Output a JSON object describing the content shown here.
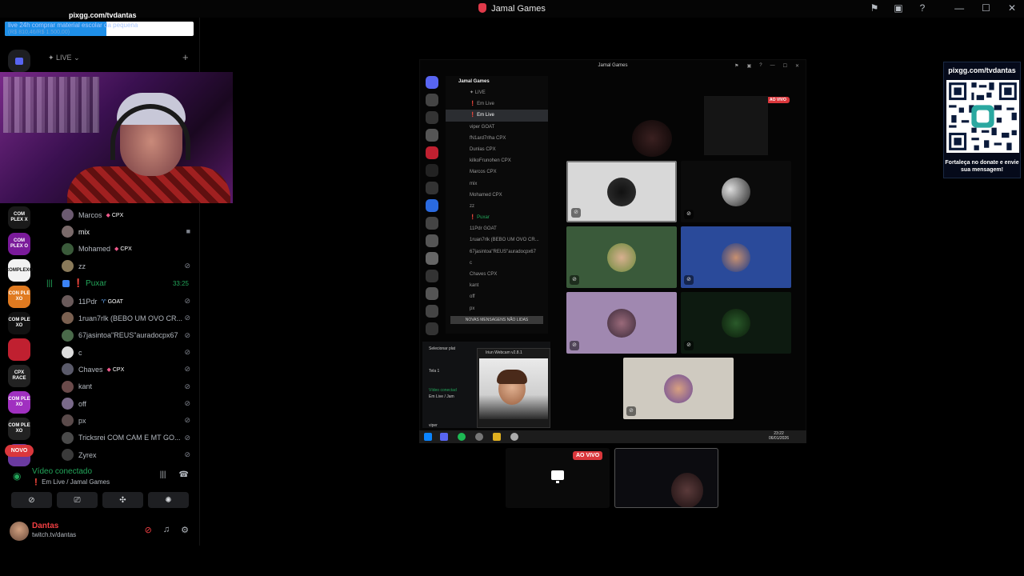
{
  "window": {
    "title": "Jamal Games"
  },
  "stream_overlay": {
    "url": "pixgg.com/tvdantas",
    "goal_text": "live 24h comprar material escolar da pequena",
    "goal_amount": "(R$ 810,46/R$ 1.500,00)",
    "goal_progress": 0.54
  },
  "sidebar": {
    "live_category": "✦ LIVE",
    "novo_badge": "NOVO",
    "members_top": [
      {
        "name": "Marcos",
        "badge": "CPX",
        "badge_type": "gem",
        "muted": false,
        "avatar_color": "#6b5a70"
      },
      {
        "name": "mix",
        "badge": "",
        "badge_type": "",
        "muted": false,
        "camera": true,
        "avatar_color": "#7a6a6a"
      },
      {
        "name": "Mohamed",
        "badge": "CPX",
        "badge_type": "gem",
        "muted": false,
        "avatar_color": "#3a5a3a"
      },
      {
        "name": "zz",
        "badge": "",
        "badge_type": "",
        "muted": true,
        "avatar_color": "#8a7a5a"
      }
    ],
    "voice_channel": {
      "name": "❗ Puxar",
      "time": "33:25"
    },
    "members_bottom": [
      {
        "name": "11Pdr",
        "badge": "GOAT",
        "badge_type": "goat",
        "avatar_color": "#6a5a5a"
      },
      {
        "name": "1ruan7rlk (BEBO UM OVO CR...",
        "badge": "",
        "badge_type": "",
        "avatar_color": "#7a6050"
      },
      {
        "name": "67jasintoa\"REUS\"auradocpx67",
        "badge": "",
        "badge_type": "",
        "avatar_color": "#4a6a4a"
      },
      {
        "name": "c",
        "badge": "",
        "badge_type": "",
        "avatar_color": "#ddd"
      },
      {
        "name": "Chaves",
        "badge": "CPX",
        "badge_type": "gem",
        "avatar_color": "#5a5a6a"
      },
      {
        "name": "kant",
        "badge": "",
        "badge_type": "",
        "avatar_color": "#6a4a4a"
      },
      {
        "name": "off",
        "badge": "",
        "badge_type": "",
        "avatar_color": "#7a6a8a"
      },
      {
        "name": "px",
        "badge": "",
        "badge_type": "",
        "avatar_color": "#5a4a4a"
      },
      {
        "name": "Tricksrei COM CAM E MT GO...",
        "badge": "",
        "badge_type": "",
        "avatar_color": "#4a4a4a"
      },
      {
        "name": "Zyrex",
        "badge": "",
        "badge_type": "",
        "avatar_color": "#3a3a3a"
      }
    ],
    "servers": [
      {
        "label": "COM PLEX X",
        "color": "#1a1a1a"
      },
      {
        "label": "COM PLEX O",
        "color": "#7a1a9a"
      },
      {
        "label": "COMPLEXO",
        "color": "#f2f2f2"
      },
      {
        "label": "CON PLE XO",
        "color": "#e07a20"
      },
      {
        "label": "COM PLE XO",
        "color": "#111"
      },
      {
        "label": "",
        "color": "#c02030"
      },
      {
        "label": "CPX RACE",
        "color": "#222"
      },
      {
        "label": "COM PLE XO",
        "color": "#a030c0"
      },
      {
        "label": "COM PLE XO",
        "color": "#222"
      },
      {
        "label": "",
        "color": "#6a3aa0"
      }
    ]
  },
  "voice_panel": {
    "title": "Vídeo conectado",
    "subtitle": "❗ Em Live / Jamal Games"
  },
  "user": {
    "name": "Dantas",
    "status": "twitch.tv/dantas"
  },
  "embed": {
    "title": "Jamal Games",
    "server_name": "Jamal Games",
    "channels": [
      {
        "label": "✦ LIVE",
        "style": ""
      },
      {
        "label": "❗ Em Live",
        "style": ""
      },
      {
        "label": "❗ Em Live",
        "style": "active"
      },
      {
        "label": "viper  GOAT",
        "style": ""
      },
      {
        "label": "fN1ard7rlha  CPX",
        "style": ""
      },
      {
        "label": "Dunlas  CPX",
        "style": ""
      },
      {
        "label": "kilkoFrunohen  CPX",
        "style": ""
      },
      {
        "label": "Marcos  CPX",
        "style": ""
      },
      {
        "label": "mix",
        "style": ""
      },
      {
        "label": "Mohamed  CPX",
        "style": ""
      },
      {
        "label": "zz",
        "style": ""
      },
      {
        "label": "❗ Puxar",
        "style": "green"
      },
      {
        "label": "11Pdr  GOAT",
        "style": ""
      },
      {
        "label": "1ruan7rlk (BEBO UM OVO CR...",
        "style": ""
      },
      {
        "label": "67jasintoa\"REUS\"auradocpx67",
        "style": ""
      },
      {
        "label": "c",
        "style": ""
      },
      {
        "label": "Chaves  CPX",
        "style": ""
      },
      {
        "label": "kant",
        "style": ""
      },
      {
        "label": "off",
        "style": ""
      },
      {
        "label": "px",
        "style": ""
      }
    ],
    "unread_banner": "NOVAS MENSAGENS NÃO LIDAS",
    "live_badge": "AO VIVO",
    "popup": {
      "select_label": "Selecionar plat",
      "tela_label": "Tela 1",
      "video_label": "Vídeo conectad",
      "video_sub": "Em Live / Jam",
      "viper_label": "viper"
    },
    "webcam_window_title": "Iriun Webcam v2.8.1",
    "clock_time": "23:22",
    "clock_date": "06/01/2026"
  },
  "bottom_tiles": {
    "live_badge": "AO VIVO"
  },
  "qr_overlay": {
    "url": "pixgg.com/tvdantas",
    "message": "Fortaleça no donate e envie sua mensagem!"
  }
}
